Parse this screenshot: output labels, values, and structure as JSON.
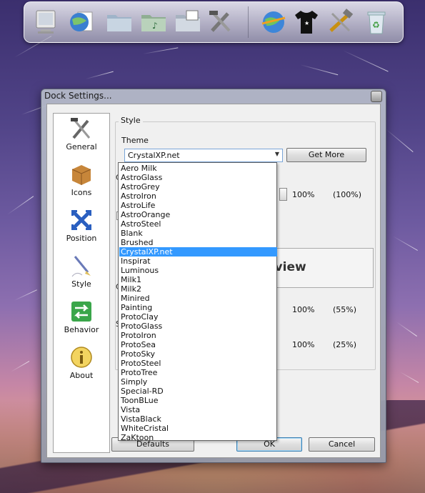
{
  "dock": {
    "icons": [
      "computer-icon",
      "globe-document-icon",
      "folder-icon",
      "music-folder-icon",
      "photo-folder-icon",
      "tools-icon",
      "network-globe-icon",
      "tshirt-icon",
      "hammer-wrench-icon",
      "recycle-bin-icon"
    ]
  },
  "window": {
    "title": "Dock Settings...",
    "categories": [
      {
        "label": "General",
        "icon": "tools-icon"
      },
      {
        "label": "Icons",
        "icon": "box-icon"
      },
      {
        "label": "Position",
        "icon": "move-arrows-icon"
      },
      {
        "label": "Style",
        "icon": "paintbrush-icon"
      },
      {
        "label": "Behavior",
        "icon": "behavior-arrows-icon"
      },
      {
        "label": "About",
        "icon": "info-icon"
      }
    ],
    "selected_category": "Style",
    "style_group": {
      "title": "Style",
      "theme_label": "Theme",
      "theme_value": "CrystalXP.net",
      "get_more_label": "Get More",
      "preview_text": "eview",
      "hidden_label_1": "C",
      "hidden_label_2": "C",
      "hidden_label_3": "S",
      "opacity_value": "100%",
      "opacity_extra": "(100%)",
      "row2_value": "100%",
      "row2_extra": "(55%)",
      "row3_value": "100%",
      "row3_extra": "(25%)"
    },
    "buttons": {
      "defaults": "Defaults",
      "ok": "OK",
      "cancel": "Cancel"
    }
  },
  "theme_options": [
    "Aero Milk",
    "AstroGlass",
    "AstroGrey",
    "AstroIron",
    "AstroLife",
    "AstroOrange",
    "AstroSteel",
    "Blank",
    "Brushed",
    "CrystalXP.net",
    "Inspirat",
    "Luminous",
    "Milk1",
    "Milk2",
    "Minired",
    "Painting",
    "ProtoClay",
    "ProtoGlass",
    "ProtoIron",
    "ProtoSea",
    "ProtoSky",
    "ProtoSteel",
    "ProtoTree",
    "Simply",
    "Special-RD",
    "ToonBLue",
    "Vista",
    "VistaBlack",
    "WhiteCristal",
    "ZaKtoon"
  ],
  "selected_theme_index": 9,
  "colors": {
    "selection": "#3399ff",
    "window_bg": "#f0f0f0"
  }
}
